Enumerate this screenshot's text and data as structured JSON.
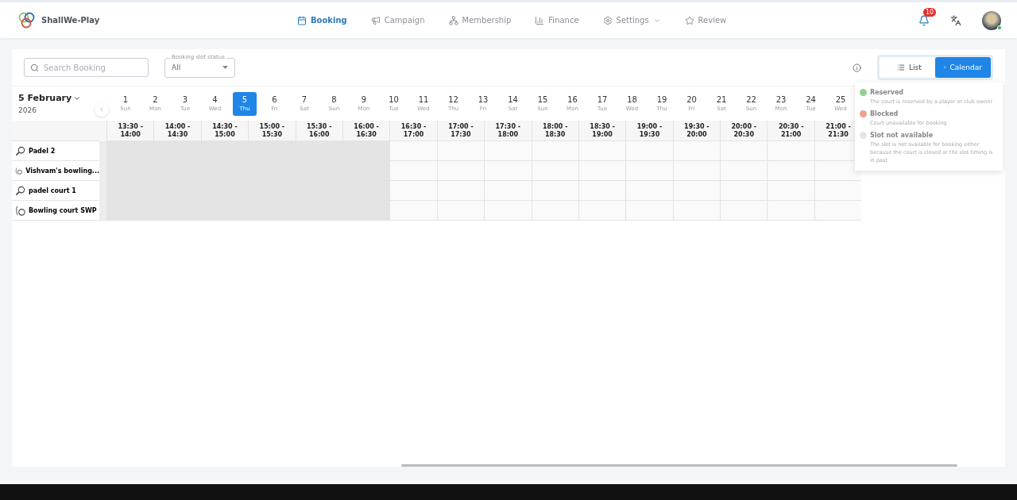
{
  "brand": {
    "name": "ShallWe-Play"
  },
  "nav": [
    {
      "label": "Booking",
      "selected": true
    },
    {
      "label": "Campaign",
      "selected": false
    },
    {
      "label": "Membership",
      "selected": false
    },
    {
      "label": "Finance",
      "selected": false
    },
    {
      "label": "Settings",
      "selected": false,
      "dropdown": true
    },
    {
      "label": "Review",
      "selected": false
    }
  ],
  "notifications": {
    "count": "10"
  },
  "search": {
    "placeholder": "Search Booking"
  },
  "status_filter": {
    "label": "Booking slot status",
    "value": "All"
  },
  "view_toggle": [
    {
      "label": "List",
      "selected": false
    },
    {
      "label": "Calendar",
      "selected": true
    }
  ],
  "date": {
    "month": "5 February",
    "year": "2026"
  },
  "days": [
    {
      "day": "1",
      "weekday": "Sun",
      "selected": false
    },
    {
      "day": "2",
      "weekday": "Mon",
      "selected": false
    },
    {
      "day": "3",
      "weekday": "Tue",
      "selected": false
    },
    {
      "day": "4",
      "weekday": "Wed",
      "selected": false
    },
    {
      "day": "5",
      "weekday": "Thu",
      "selected": true
    },
    {
      "day": "6",
      "weekday": "Fri",
      "selected": false
    },
    {
      "day": "7",
      "weekday": "Sat",
      "selected": false
    },
    {
      "day": "8",
      "weekday": "Sun",
      "selected": false
    },
    {
      "day": "9",
      "weekday": "Mon",
      "selected": false
    },
    {
      "day": "10",
      "weekday": "Tue",
      "selected": false
    },
    {
      "day": "11",
      "weekday": "Wed",
      "selected": false
    },
    {
      "day": "12",
      "weekday": "Thu",
      "selected": false
    },
    {
      "day": "13",
      "weekday": "Fri",
      "selected": false
    },
    {
      "day": "14",
      "weekday": "Sat",
      "selected": false
    },
    {
      "day": "15",
      "weekday": "Sun",
      "selected": false
    },
    {
      "day": "16",
      "weekday": "Mon",
      "selected": false
    },
    {
      "day": "17",
      "weekday": "Tue",
      "selected": false
    },
    {
      "day": "18",
      "weekday": "Wed",
      "selected": false
    },
    {
      "day": "19",
      "weekday": "Thu",
      "selected": false
    },
    {
      "day": "20",
      "weekday": "Fri",
      "selected": false
    },
    {
      "day": "21",
      "weekday": "Sat",
      "selected": false
    },
    {
      "day": "22",
      "weekday": "Sun",
      "selected": false
    },
    {
      "day": "23",
      "weekday": "Mon",
      "selected": false
    },
    {
      "day": "24",
      "weekday": "Tue",
      "selected": false
    },
    {
      "day": "25",
      "weekday": "Wed",
      "selected": false
    }
  ],
  "time_slots": [
    {
      "start": "13:30 -",
      "end": "14:00",
      "past": true
    },
    {
      "start": "14:00 -",
      "end": "14:30",
      "past": true
    },
    {
      "start": "14:30 -",
      "end": "15:00",
      "past": true
    },
    {
      "start": "15:00 -",
      "end": "15:30",
      "past": true
    },
    {
      "start": "15:30 -",
      "end": "16:00",
      "past": true
    },
    {
      "start": "16:00 -",
      "end": "16:30",
      "past": true
    },
    {
      "start": "16:30 -",
      "end": "17:00",
      "past": false
    },
    {
      "start": "17:00 -",
      "end": "17:30",
      "past": false
    },
    {
      "start": "17:30 -",
      "end": "18:00",
      "past": false
    },
    {
      "start": "18:00 -",
      "end": "18:30",
      "past": false
    },
    {
      "start": "18:30 -",
      "end": "19:00",
      "past": false
    },
    {
      "start": "19:00 -",
      "end": "19:30",
      "past": false
    },
    {
      "start": "19:30 -",
      "end": "20:00",
      "past": false
    },
    {
      "start": "20:00 -",
      "end": "20:30",
      "past": false
    },
    {
      "start": "20:30 -",
      "end": "21:00",
      "past": false
    },
    {
      "start": "21:00 -",
      "end": "21:30",
      "past": false
    }
  ],
  "courts": [
    {
      "name": "Padel 2",
      "kind": "padel"
    },
    {
      "name": "Vishvam's bowling...",
      "kind": "bowling"
    },
    {
      "name": "padel court 1",
      "kind": "padel"
    },
    {
      "name": "Bowling court SWP",
      "kind": "bowling"
    }
  ],
  "legend": [
    {
      "title": "Reserved",
      "description": "The court is reserved by a player or club owner",
      "color": "#8fd18f"
    },
    {
      "title": "Blocked",
      "description": "Court unavailable for booking",
      "color": "#f0a090"
    },
    {
      "title": "Slot not available",
      "description": "The slot is not available for booking either because the court is closed or the slot timing is in past",
      "color": "#e4e4e4"
    }
  ]
}
